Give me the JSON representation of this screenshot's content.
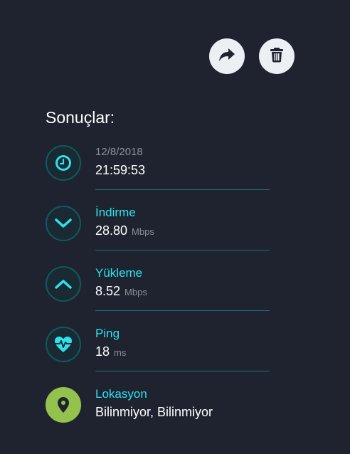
{
  "actions": {
    "share_icon": "share-arrow-icon",
    "delete_icon": "trash-icon"
  },
  "results": {
    "title": "Sonuçlar:",
    "time": {
      "date": "12/8/2018",
      "time": "21:59:53"
    },
    "download": {
      "label": "İndirme",
      "value": "28.80",
      "unit": "Mbps"
    },
    "upload": {
      "label": "Yükleme",
      "value": "8.52",
      "unit": "Mbps"
    },
    "ping": {
      "label": "Ping",
      "value": "18",
      "unit": "ms"
    },
    "location": {
      "label": "Lokasyon",
      "value": "Bilinmiyor, Bilinmiyor"
    }
  },
  "colors": {
    "background": "#1f2330",
    "accent": "#2be3ee",
    "ring": "#0f5a5f",
    "divider": "#1f6f73",
    "location": "#93c24d",
    "button": "#eceff3"
  }
}
